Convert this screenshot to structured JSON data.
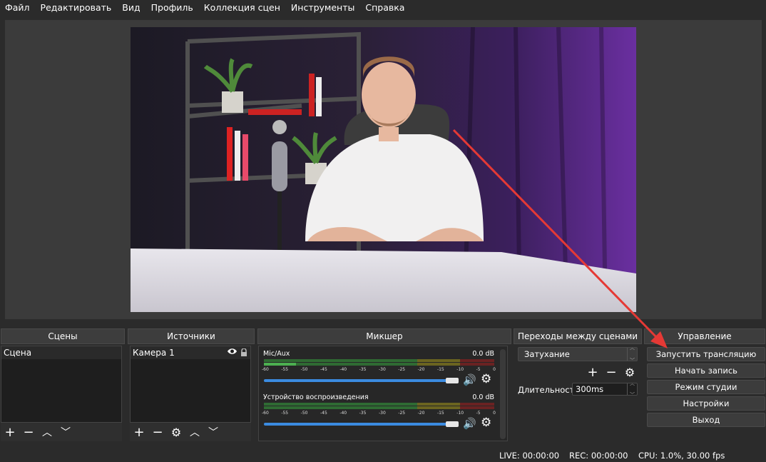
{
  "menu": {
    "items": [
      {
        "label": "Файл"
      },
      {
        "label": "Редактировать"
      },
      {
        "label": "Вид"
      },
      {
        "label": "Профиль"
      },
      {
        "label": "Коллекция сцен"
      },
      {
        "label": "Инструменты"
      },
      {
        "label": "Справка"
      }
    ]
  },
  "docks": {
    "scenes": {
      "title": "Сцены",
      "items": [
        "Сцена"
      ]
    },
    "sources": {
      "title": "Источники",
      "items": [
        "Камера 1"
      ]
    },
    "mixer": {
      "title": "Микшер",
      "channels": [
        {
          "name": "Mic/Aux",
          "db": "0.0 dB"
        },
        {
          "name": "Устройство воспроизведения",
          "db": "0.0 dB"
        }
      ],
      "ticks": [
        "-60",
        "-55",
        "-50",
        "-45",
        "-40",
        "-35",
        "-30",
        "-25",
        "-20",
        "-15",
        "-10",
        "-5",
        "0"
      ]
    },
    "transitions": {
      "title": "Переходы между сценами",
      "selected": "Затухание",
      "duration_label": "Длительность",
      "duration_value": "300ms"
    },
    "controls": {
      "title": "Управление",
      "buttons": [
        "Запустить трансляцию",
        "Начать запись",
        "Режим студии",
        "Настройки",
        "Выход"
      ]
    }
  },
  "status": {
    "live": "LIVE: 00:00:00",
    "rec": "REC: 00:00:00",
    "cpu": "CPU: 1.0%, 30.00 fps"
  },
  "colors": {
    "accent": "#3b8be0",
    "annotation_arrow": "#e53935",
    "meter_green": "#4caf50",
    "meter_yellow": "#c8b400",
    "meter_red": "#c62828"
  }
}
